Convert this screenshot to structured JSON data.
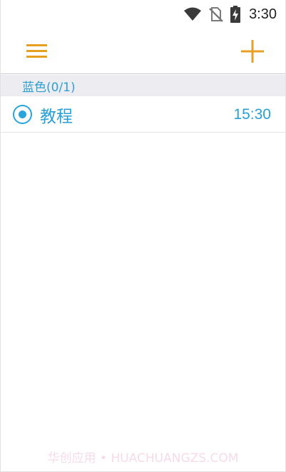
{
  "status_bar": {
    "time": "3:30",
    "icons": [
      "wifi-icon",
      "no-sim-icon",
      "battery-charging-icon"
    ]
  },
  "toolbar": {
    "menu_icon": "hamburger-menu-icon",
    "add_icon": "plus-icon",
    "accent_color": "#e8a020"
  },
  "section": {
    "header": "蓝色(0/1)",
    "color": "#2f9fd0"
  },
  "items": [
    {
      "title": "教程",
      "time": "15:30",
      "selected": true,
      "color": "#2aa5dc"
    }
  ],
  "watermark": "华创应用 • HUACHUANGZS.COM"
}
